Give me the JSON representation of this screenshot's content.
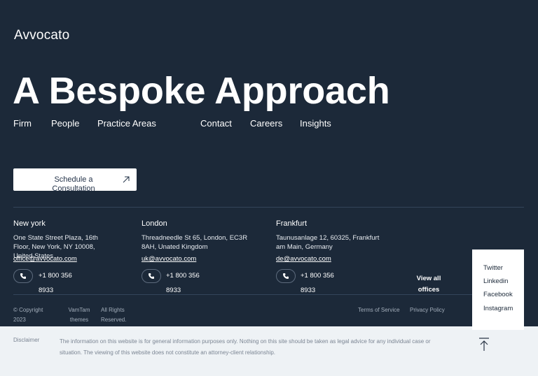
{
  "brand": {
    "logo": "Avvocato"
  },
  "hero": {
    "headline": "A Bespoke Approach"
  },
  "nav": [
    {
      "label": "Firm"
    },
    {
      "label": "People"
    },
    {
      "label": "Practice Areas"
    },
    {
      "label": "Contact"
    },
    {
      "label": "Careers"
    },
    {
      "label": "Insights"
    }
  ],
  "cta": {
    "label": "Schedule a Consultation",
    "icon": "arrow-up-right-icon"
  },
  "offices": [
    {
      "city": "New york",
      "address": "One State Street Plaza, 16th Floor, New York, NY 10008, United States",
      "email": "office@avvocato.com",
      "phone_a": "+1 800 356",
      "phone_b": "8933"
    },
    {
      "city": "London",
      "address": "Threadneedle St 65, London, EC3R 8AH, Unated Kingdom",
      "email": "uk@avvocato.com",
      "phone_a": "+1 800 356",
      "phone_b": "8933"
    },
    {
      "city": "Frankfurt",
      "address": "Taunusanlage 12, 60325, Frankfurt am Main, Germany",
      "email": "de@avvocato.com",
      "phone_a": "+1 800 356",
      "phone_b": "8933"
    }
  ],
  "view_all": {
    "line1": "View all",
    "line2": "offices"
  },
  "footer": {
    "copyright_1": "© Copyright",
    "copyright_2": "2023",
    "vamtam_1": "VamTam",
    "vamtam_2": "themes",
    "rights_1": "All Rights",
    "rights_2": "Reserved.",
    "terms": "Terms of Service",
    "privacy": "Privacy Policy"
  },
  "social": [
    "Twitter",
    "Linkedin",
    "Facebook",
    "Instagram"
  ],
  "disclaimer": {
    "label": "Disclaimer",
    "text": "The information on this website is for general information purposes only. Nothing on this site should be taken as legal advice for any individual case or situation. The viewing of this website does not constitute an attorney-client relationship."
  },
  "colors": {
    "background": "#1c2939",
    "panel": "#ffffff",
    "disclaimer_bg": "#eef2f5"
  }
}
